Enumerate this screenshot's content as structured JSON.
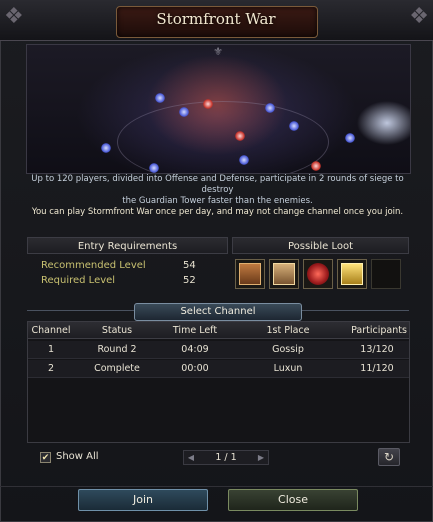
{
  "window": {
    "title": "Stormfront War"
  },
  "description": {
    "line1": "Up to 120 players, divided into Offense and Defense, participate in 2 rounds of siege to destroy",
    "line2": "the Guardian Tower faster than the enemies.",
    "line3": "You can play Stormfront War once per day, and may not change channel once you join."
  },
  "entry_requirements": {
    "title": "Entry Requirements",
    "rows": [
      {
        "label": "Recommended Level",
        "value": "54"
      },
      {
        "label": "Required Level",
        "value": "52"
      }
    ]
  },
  "possible_loot": {
    "title": "Possible Loot",
    "items": [
      {
        "icon": "brown-chest-icon",
        "color": "#a86a3a"
      },
      {
        "icon": "wooden-chest-icon",
        "color": "#b8905a"
      },
      {
        "icon": "red-crest-icon",
        "color": "#c0262c"
      },
      {
        "icon": "gold-chest-icon",
        "color": "#d9b23a"
      },
      {
        "icon": "empty-slot",
        "color": "#1a1814"
      }
    ]
  },
  "channel_section": {
    "title": "Select Channel",
    "columns": [
      "Channel",
      "Status",
      "Time Left",
      "1st Place",
      "Participants"
    ],
    "rows": [
      {
        "channel": "1",
        "status": "Round 2",
        "time_left": "04:09",
        "first_place": "Gossip",
        "participants": "13/120"
      },
      {
        "channel": "2",
        "status": "Complete",
        "time_left": "00:00",
        "first_place": "Luxun",
        "participants": "11/120"
      }
    ]
  },
  "controls": {
    "show_all_label": "Show All",
    "show_all_checked": true,
    "page_indicator": "1 / 1",
    "join_label": "Join",
    "close_label": "Close"
  }
}
